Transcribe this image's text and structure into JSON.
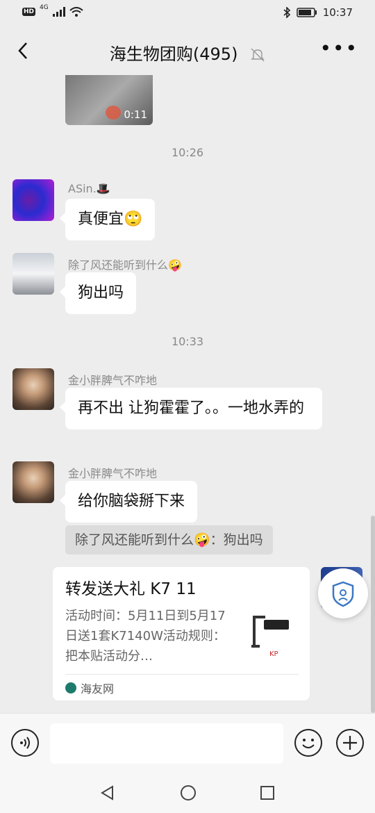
{
  "status_bar": {
    "left_badge": "HD",
    "network": "4G",
    "time": "10:37"
  },
  "header": {
    "title": "海生物团购(495)",
    "icons": [
      "back-icon",
      "mute-bell-icon",
      "more-icon"
    ]
  },
  "messages": {
    "video_duration": "0:11",
    "time1": "10:26",
    "m1": {
      "sender": "ASin.🎩",
      "text": "真便宜🙄"
    },
    "m2": {
      "sender": "除了风还能听到什么🤪",
      "text": "狗出吗"
    },
    "time2": "10:33",
    "m3": {
      "sender": "金小胖脾气不咋地",
      "text": "再不出 让狗霍霍了。。一地水弄的"
    },
    "m4": {
      "sender": "金小胖脾气不咋地",
      "text": "给你脑袋掰下来"
    },
    "quote": "除了风还能听到什么🤪：狗出吗",
    "card": {
      "title": "转发送大礼 K7 11",
      "desc": "活动时间：5月11日到5月17日送1套K7140W活动规则：把本贴活动分…",
      "source": "海友网"
    }
  },
  "colors": {
    "background": "#ededed",
    "bubble": "#ffffff",
    "quote_bg": "#dcdcdc",
    "time_text": "#888888"
  }
}
